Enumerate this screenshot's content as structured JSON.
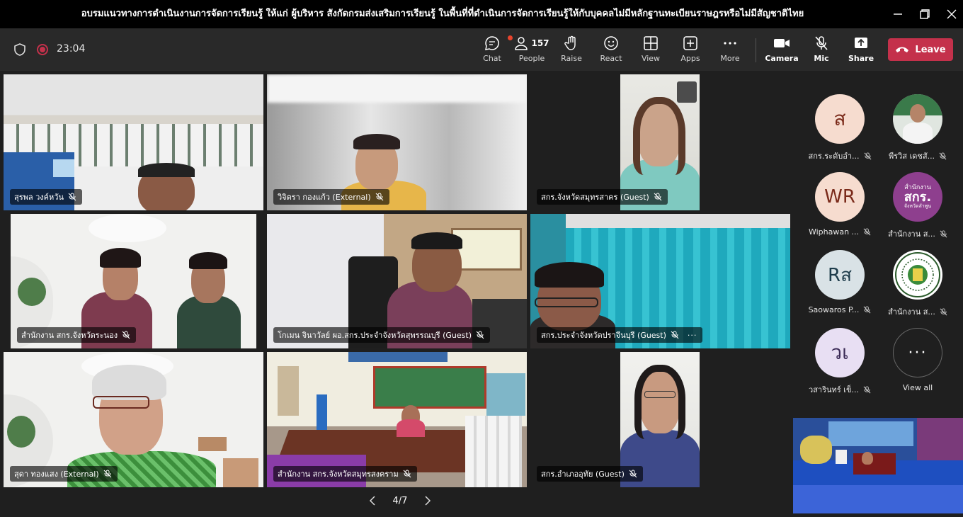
{
  "window": {
    "title": "อบรมแนวทางการดำเนินงานการจัดการเรียนรู้ ให้แก่ ผู้บริหาร สังกัดกรมส่งเสริมการเรียนรู้ ในพื้นที่ที่ดำเนินการจัดการเรียนรู้ให้กับบุคคลไม่มีหลักฐานทะเบียนราษฎรหรือไม่มีสัญชาติไทย"
  },
  "toolbar": {
    "timer": "23:04",
    "chat_label": "Chat",
    "people_label": "People",
    "people_count": "157",
    "raise_label": "Raise",
    "react_label": "React",
    "view_label": "View",
    "apps_label": "Apps",
    "more_label": "More",
    "camera_label": "Camera",
    "mic_label": "Mic",
    "share_label": "Share",
    "leave_label": "Leave"
  },
  "tiles": [
    {
      "name": "สุรพล วงค์หวัน"
    },
    {
      "name": "วิจิตรา กองแก้ว (External)"
    },
    {
      "name": "สกร.จังหวัดสมุทรสาคร (Guest)"
    },
    {
      "name": "สำนักงาน สกร.จังหวัดระนอง"
    },
    {
      "name": "โกเมน จินาวัลย์ ผอ.สกร.ประจำจังหวัดสุพรรณบุรี (Guest)"
    },
    {
      "name": "สกร.ประจำจังหวัดปราจีนบุรี (Guest)"
    },
    {
      "name": "สุดา ทองแสง (External)"
    },
    {
      "name": "สำนักงาน สกร.จังหวัดสมุทรสงคราม"
    },
    {
      "name": "สกร.อำเภออุทัย (Guest)"
    }
  ],
  "roster": [
    {
      "initials": "ส",
      "name": "สกร.ระดับอำ..."
    },
    {
      "initials": "",
      "name": "พีรวิส เดชสั..."
    },
    {
      "initials": "WR",
      "name": "Wiphawan ..."
    },
    {
      "initials": "",
      "name": "สำนักงาน ส...",
      "logo_text": "สำนักงาน",
      "logo_big": "สกร.",
      "logo_small": "จังหวัดลำพูน"
    },
    {
      "initials": "Rส",
      "name": "Saowaros P..."
    },
    {
      "initials": "",
      "name": "สำนักงาน ส..."
    },
    {
      "initials": "วเ",
      "name": "วสารินทร์ เข็..."
    },
    {
      "initials": "···",
      "name": "View all"
    }
  ],
  "pager": {
    "label": "4/7"
  },
  "colors": {
    "leave": "#c4314b",
    "toolbar": "#292929",
    "background": "#1f1f1f",
    "avatar_peach": "#f6dccf"
  }
}
